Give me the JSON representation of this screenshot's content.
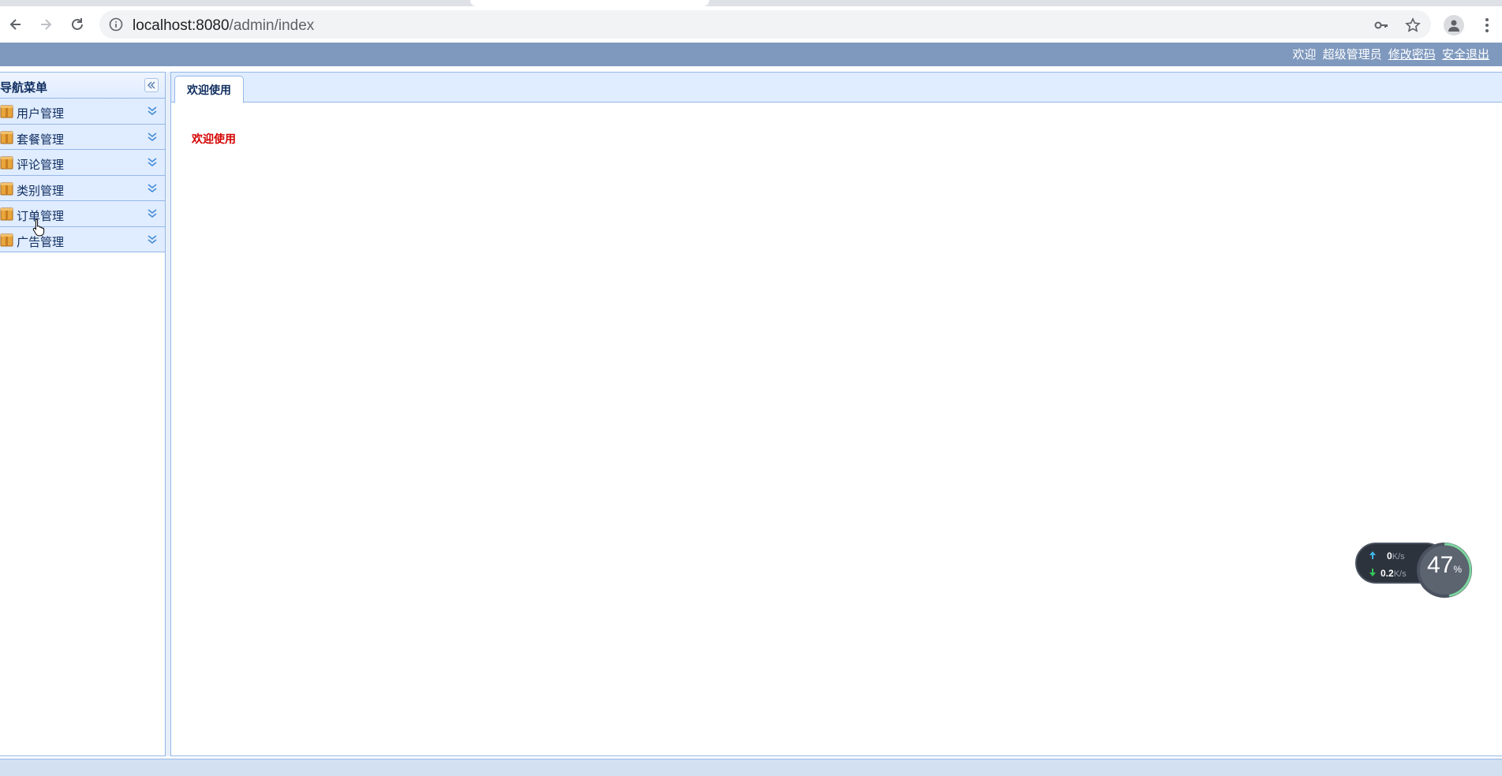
{
  "browser": {
    "url_host": "localhost:8080",
    "url_path": "/admin/index"
  },
  "header": {
    "greeting": "欢迎",
    "username": "超级管理员",
    "change_password": "修改密码",
    "logout": "安全退出"
  },
  "sidebar": {
    "title": "导航菜单",
    "items": [
      {
        "label": "用户管理"
      },
      {
        "label": "套餐管理"
      },
      {
        "label": "评论管理"
      },
      {
        "label": "类别管理"
      },
      {
        "label": "订单管理"
      },
      {
        "label": "广告管理"
      }
    ]
  },
  "main": {
    "tab_label": "欢迎使用",
    "welcome_text": "欢迎使用"
  },
  "netwidget": {
    "upload_value": "0",
    "upload_unit": "K/s",
    "download_value": "0.2",
    "download_unit": "K/s",
    "percent": "47",
    "percent_sign": "%"
  },
  "colors": {
    "header_bg": "#7f99be",
    "panel_header_bg": "#e0ecff",
    "border": "#95b8e7",
    "welcome_red": "#d40000"
  }
}
